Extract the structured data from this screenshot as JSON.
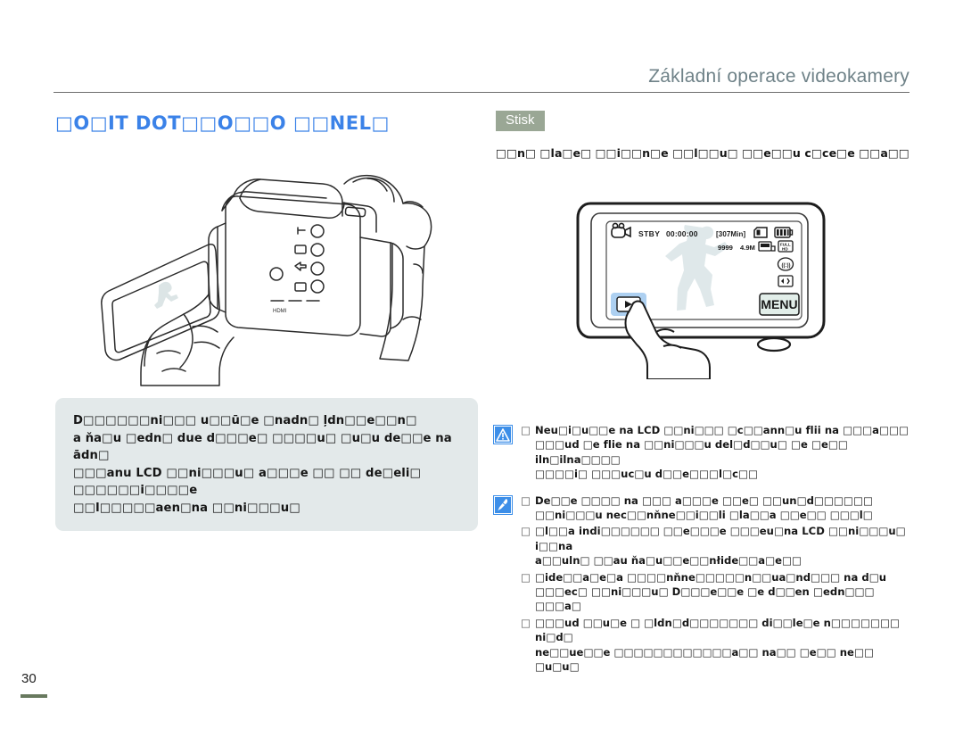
{
  "header": {
    "title": "Základní operace videokamery"
  },
  "section": {
    "title": "□O□IT DOT□□O□□O □□NEL□"
  },
  "left": {
    "illustration_name": "camcorder-held-in-hands-illustration",
    "tip_box": {
      "text": "D□□□□□□ni□□□ u□□ū□e □nadn□ ļdn□□e□□n□\na ňa□u □edn□ due d□□□e□ □□□□u□ □u□u de□□e na ādn□\n□□□anu LCD □□ni□□□u□ a□□□e □□ □□ de□eli□ □□□□□□i□□□□e\n□□l□□□□□aen□na □□ni□□□u□"
    }
  },
  "right": {
    "badge_label": "Stisk",
    "intro_text": "□□n□ □la□e□ □□i□□n□e □□l□□u□ □□e□□u c□ce□e □□a□□",
    "lcd": {
      "name": "camcorder-lcd-screen-illustration",
      "mode_icon": "camcorder-record-icon",
      "status_label": "STBY",
      "timecode": "00:00:00",
      "remaining": "[307Min]",
      "card_icon": "sd-card-icon",
      "battery_icon": "battery-full-icon",
      "counter": "9999",
      "photo_size": "4.9M",
      "storage_icon": "memory-card-icon",
      "quality_icon": "full-hd-icon",
      "anti_shake_icon": "anti-shake-icon",
      "fader_icon": "fader-icon",
      "scene_icon": "scene-mode-icon",
      "play_button_label": "▶",
      "menu_button_label": "MENU",
      "highlight_color": "#9ecbf0",
      "finger_name": "pointing-finger"
    },
    "notes": [
      {
        "icon": "caution-warning-icon",
        "icon_color": "#3c8ee8",
        "bullets": [
          "Neu□i□u□□e na LCD □□ni□□□ □c□□ann□u flii na □□□a□□□\n□□□ud □e flie na □□ni□□□u del□d□□u□ □e □e□□ iln□ilna□□□□\n□□□□i□ □□□uc□u d□□e□□□l□c□□"
        ]
      },
      {
        "icon": "note-pen-icon",
        "icon_color": "#3c8ee8",
        "bullets": [
          "De□□e □□□□ na □□□ a□□□e □□e□ □□un□d□□□□□□\n□□ni□□□u nec□□nňne□□i□□li □la□□a □□e□□ □□□l□",
          "□l□□a indi□□□□□□ □□e□□□e □□□eu□na LCD □□ni□□□u□ i□□na\na□□uln□ □□au ňa□u□□e□□nłide□□a□e□□",
          "□ide□□a□e□a □□□□nňne□□□□□n□□ua□nd□□□ na d□u\n□□□ec□ □□ni□□□u□ D□□□e□□e □e d□□en □edn□□□ □□□a□",
          "□□□ud □□u□e □ □ldn□d□□□□□□□ di□□le□e n□□□□□□□ ni□d□\nne□□ue□□e □□□□□□□□□□□□a□□ na□□ □e□□ ne□□ □u□u□"
        ]
      }
    ]
  },
  "footer": {
    "page_number": "30",
    "rule_color": "#68795e"
  }
}
